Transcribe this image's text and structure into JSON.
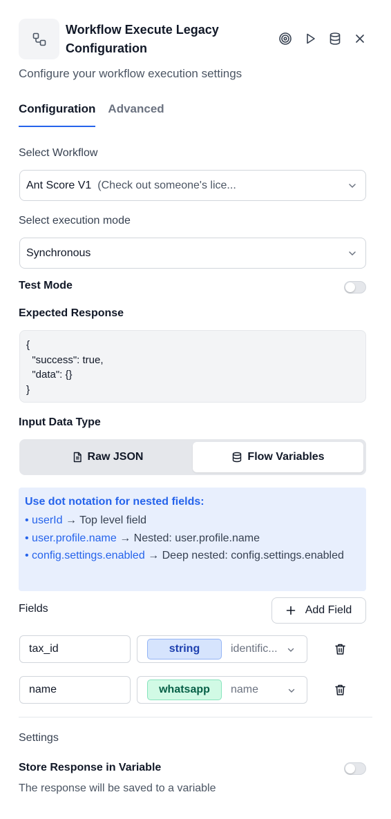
{
  "header": {
    "title": "Workflow Execute Legacy Configuration",
    "subtitle": "Configure your workflow execution settings",
    "icons": [
      "workflow-node-icon",
      "target-icon",
      "play-icon",
      "database-icon",
      "close-icon"
    ]
  },
  "tabs": [
    {
      "label": "Configuration",
      "active": true
    },
    {
      "label": "Advanced",
      "active": false
    }
  ],
  "workflow": {
    "label": "Select Workflow",
    "selected_name": "Ant Score V1",
    "selected_desc": "(Check out someone's lice..."
  },
  "execution_mode": {
    "label": "Select execution mode",
    "selected": "Synchronous"
  },
  "test_mode": {
    "label": "Test Mode",
    "enabled": false
  },
  "expected_response": {
    "label": "Expected Response",
    "value": "{\n  \"success\": true,\n  \"data\": {}\n}"
  },
  "input_data_type": {
    "label": "Input Data Type",
    "options": [
      "Raw JSON",
      "Flow Variables"
    ],
    "selected": "Flow Variables"
  },
  "info": {
    "heading": "Use dot notation for nested fields:",
    "items": [
      {
        "key": "• userId",
        "desc": " → Top level field"
      },
      {
        "key": "• user.profile.name",
        "desc": " → Nested: user.profile.name"
      },
      {
        "key": "• config.settings.enabled",
        "desc": " → Deep nested: config.settings.enabled"
      }
    ]
  },
  "fields": {
    "label": "Fields",
    "add_label": "Add Field",
    "rows": [
      {
        "name": "tax_id",
        "type": "string",
        "type_color": "blue",
        "value": "identific..."
      },
      {
        "name": "name",
        "type": "whatsapp",
        "type_color": "green",
        "value": "name"
      }
    ]
  },
  "settings": {
    "label": "Settings",
    "store_label": "Store Response in Variable",
    "store_desc": "The response will be saved to a variable",
    "store_enabled": false
  },
  "colors": {
    "accent": "#2563eb",
    "info_bg": "#e8effd",
    "string_badge": "#d6e4fd",
    "whatsapp_badge": "#d1fae5"
  }
}
